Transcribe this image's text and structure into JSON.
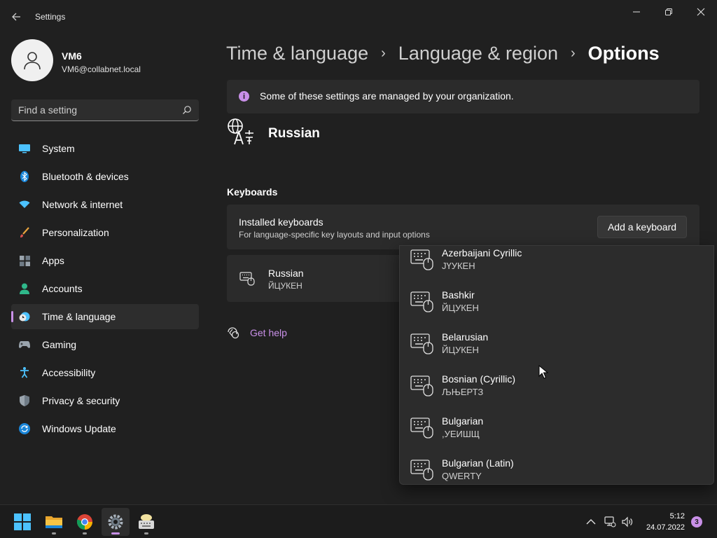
{
  "window": {
    "title": "Settings"
  },
  "profile": {
    "name": "VM6",
    "email": "VM6@collabnet.local"
  },
  "search": {
    "placeholder": "Find a setting"
  },
  "sidebar": {
    "items": [
      {
        "label": "System",
        "icon": "monitor-icon",
        "active": false
      },
      {
        "label": "Bluetooth & devices",
        "icon": "bluetooth-icon",
        "active": false
      },
      {
        "label": "Network & internet",
        "icon": "wifi-icon",
        "active": false
      },
      {
        "label": "Personalization",
        "icon": "brush-icon",
        "active": false
      },
      {
        "label": "Apps",
        "icon": "apps-icon",
        "active": false
      },
      {
        "label": "Accounts",
        "icon": "person-icon",
        "active": false
      },
      {
        "label": "Time & language",
        "icon": "clock-globe-icon",
        "active": true
      },
      {
        "label": "Gaming",
        "icon": "gamepad-icon",
        "active": false
      },
      {
        "label": "Accessibility",
        "icon": "accessibility-icon",
        "active": false
      },
      {
        "label": "Privacy & security",
        "icon": "shield-icon",
        "active": false
      },
      {
        "label": "Windows Update",
        "icon": "update-icon",
        "active": false
      }
    ]
  },
  "breadcrumb": {
    "items": [
      "Time & language",
      "Language & region"
    ],
    "current": "Options",
    "separator": "›"
  },
  "info": {
    "text": "Some of these settings are managed by your organization."
  },
  "language": {
    "name": "Russian"
  },
  "keyboards": {
    "section_title": "Keyboards",
    "card_title": "Installed keyboards",
    "card_subtitle": "For language-specific key layouts and input options",
    "add_button": "Add a keyboard",
    "installed": {
      "name": "Russian",
      "layout": "ЙЦУКЕН"
    }
  },
  "help": {
    "label": "Get help"
  },
  "flyout": {
    "items": [
      {
        "name": "Azerbaijani Cyrillic",
        "layout": "ЈҮУКЕН"
      },
      {
        "name": "Bashkir",
        "layout": "ЙЦУКЕН"
      },
      {
        "name": "Belarusian",
        "layout": "ЙЦУКЕН"
      },
      {
        "name": "Bosnian (Cyrillic)",
        "layout": "ЉЊЕРТЗ"
      },
      {
        "name": "Bulgarian",
        "layout": ",УЕИШЩ"
      },
      {
        "name": "Bulgarian (Latin)",
        "layout": "QWERTY"
      }
    ]
  },
  "taskbar": {
    "apps": [
      "start-icon",
      "file-explorer-icon",
      "chrome-icon",
      "settings-icon",
      "keyboard-app-icon"
    ],
    "time": "5:12",
    "date": "24.07.2022",
    "notifications": "3"
  },
  "colors": {
    "accent": "#c990e8",
    "background": "#202020",
    "card": "#2b2b2b"
  }
}
